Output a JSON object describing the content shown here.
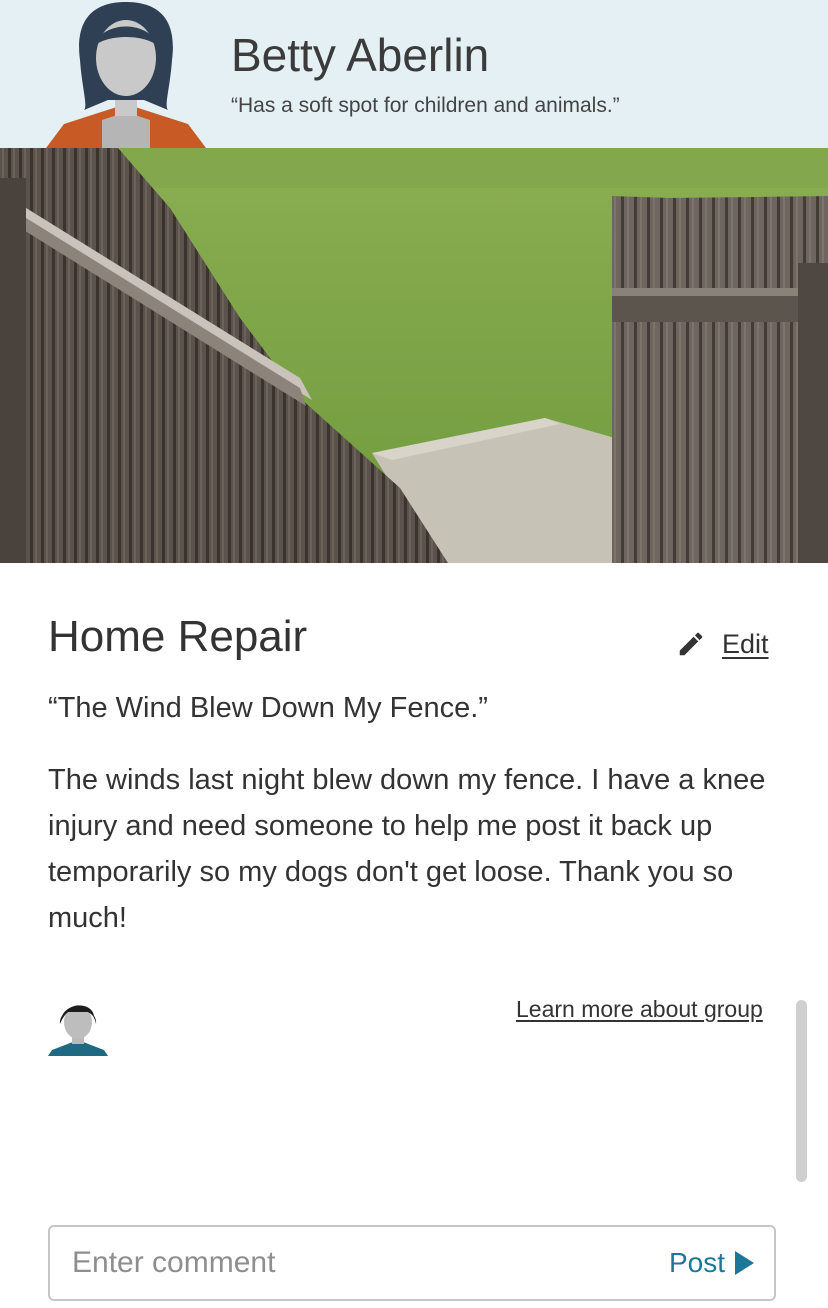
{
  "profile": {
    "name": "Betty Aberlin",
    "quote": "“Has a soft spot for children and animals.”",
    "avatar_icon": "person-avatar-icon"
  },
  "hero": {
    "icon": "broken-fence-photo"
  },
  "post": {
    "title": "Home Repair",
    "subtitle": "“The Wind Blew Down My Fence.”",
    "body": "The winds last night blew down my fence. I have a knee injury and need someone to help me post it back up temporarily so my dogs don't get loose. Thank you so much!"
  },
  "edit": {
    "label": "Edit",
    "icon": "pencil-icon"
  },
  "group": {
    "learn_more": "Learn more about group",
    "member_icon": "member-avatar-icon"
  },
  "comment": {
    "placeholder": "Enter comment",
    "post_label": "Post",
    "post_icon": "play-arrow-icon"
  },
  "colors": {
    "header_bg": "#e4f0f4",
    "accent": "#1b7898",
    "avatar_hair": "#2f4055",
    "avatar_shirt": "#c85a26",
    "member_shirt": "#1f6a82"
  }
}
